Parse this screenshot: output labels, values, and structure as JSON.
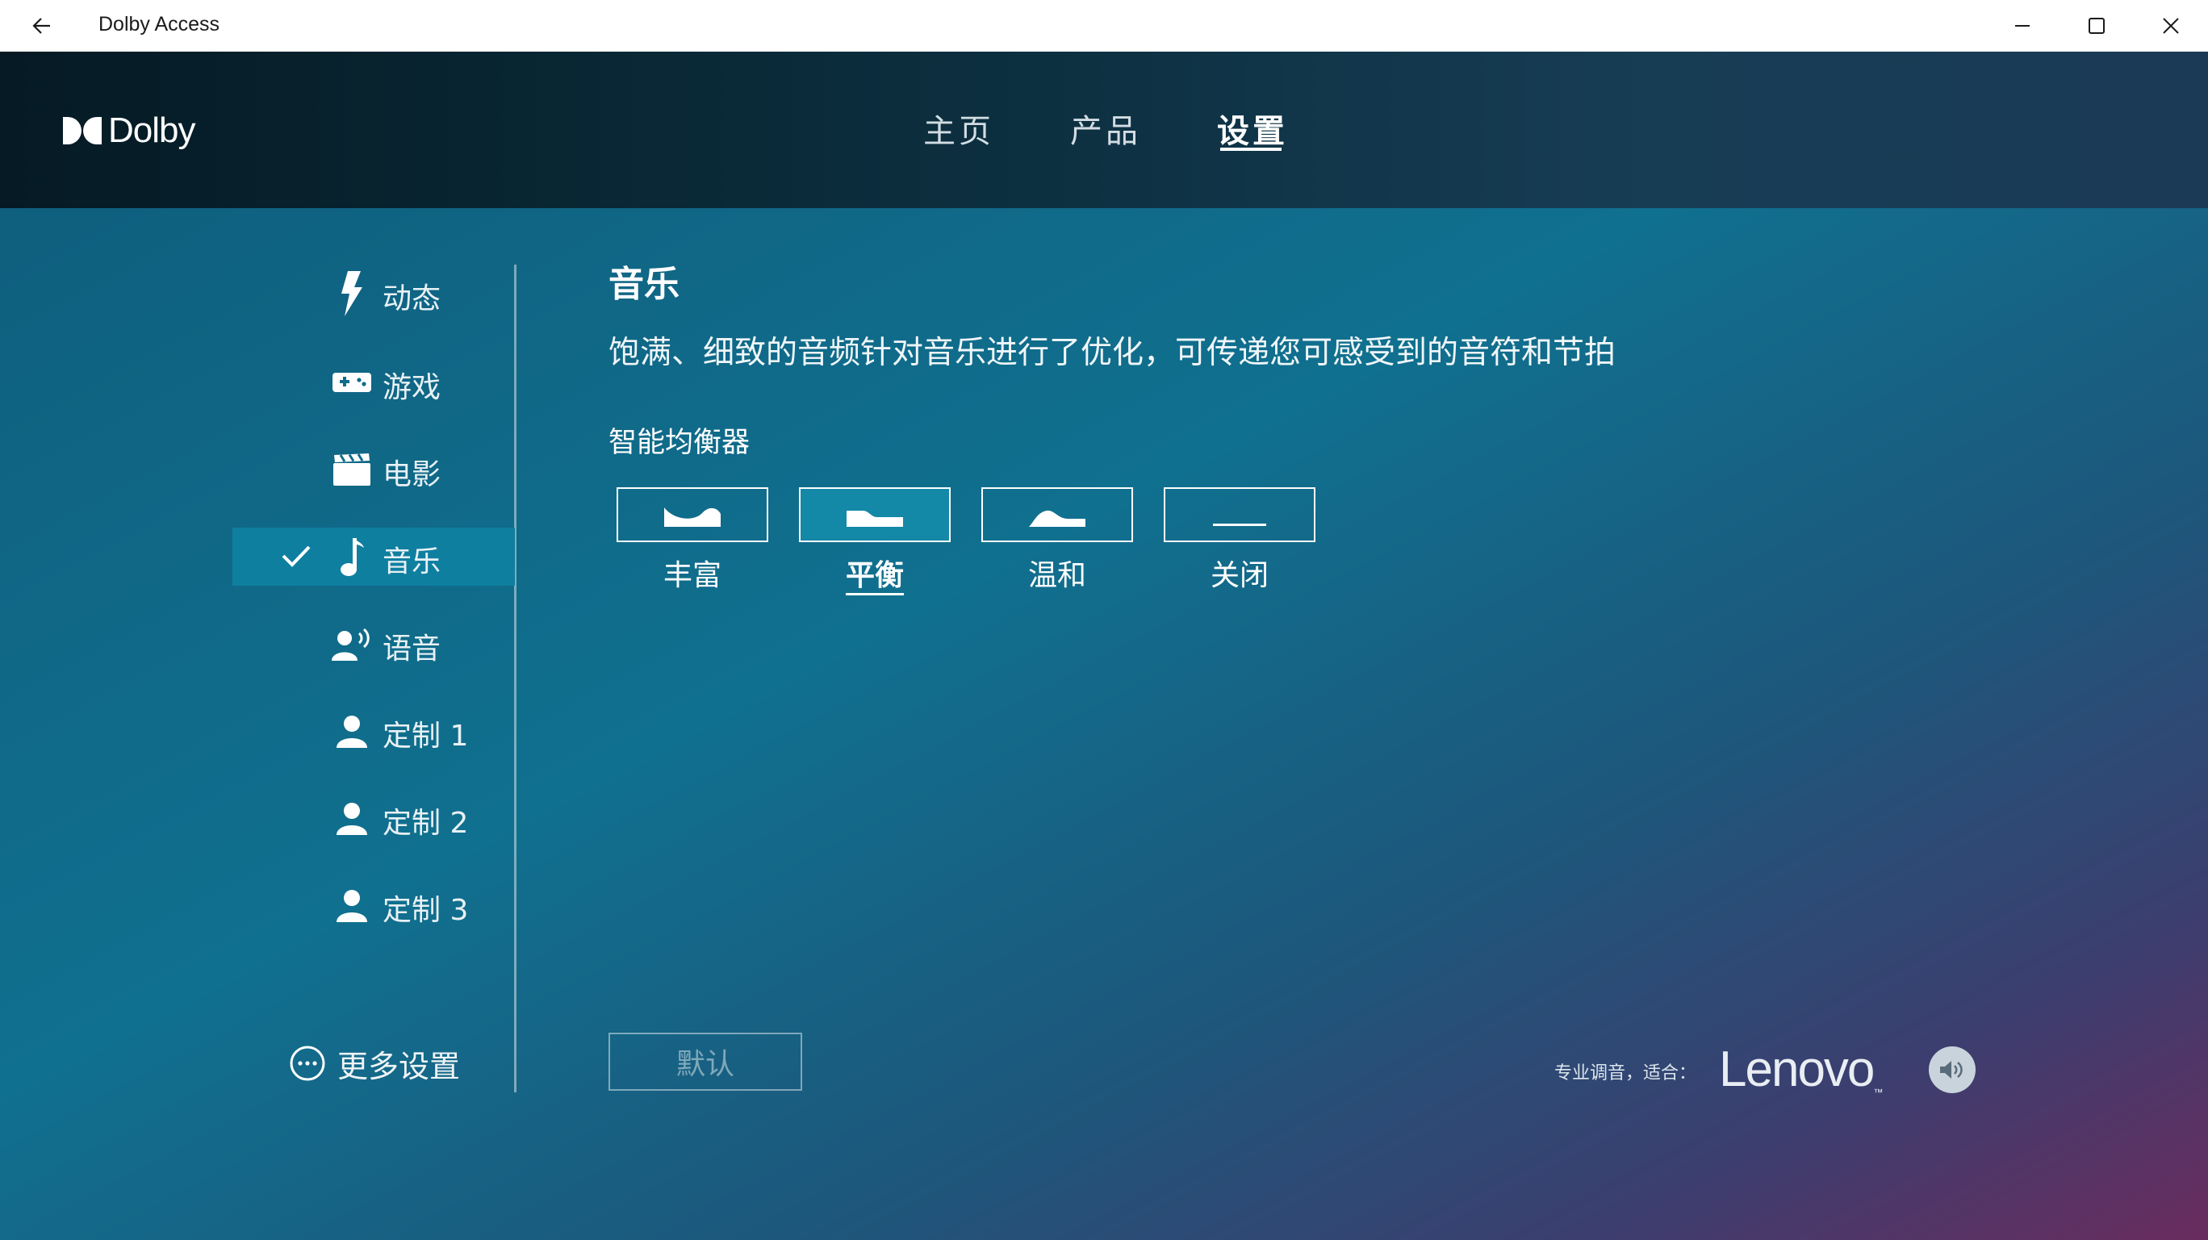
{
  "window": {
    "title": "Dolby Access",
    "icons": {
      "back": "back-arrow-icon",
      "minimize": "minimize-icon",
      "maximize": "maximize-icon",
      "close": "close-icon"
    }
  },
  "header": {
    "logo_text": "Dolby",
    "nav": [
      {
        "label": "主页",
        "active": false
      },
      {
        "label": "产品",
        "active": false
      },
      {
        "label": "设置",
        "active": true
      }
    ]
  },
  "sidebar": {
    "items": [
      {
        "label": "动态",
        "icon": "lightning-icon",
        "selected": false
      },
      {
        "label": "游戏",
        "icon": "gamepad-icon",
        "selected": false
      },
      {
        "label": "电影",
        "icon": "clapperboard-icon",
        "selected": false
      },
      {
        "label": "音乐",
        "icon": "music-note-icon",
        "selected": true
      },
      {
        "label": "语音",
        "icon": "voice-icon",
        "selected": false
      },
      {
        "label": "定制 1",
        "icon": "person-icon",
        "selected": false
      },
      {
        "label": "定制 2",
        "icon": "person-icon",
        "selected": false
      },
      {
        "label": "定制 3",
        "icon": "person-icon",
        "selected": false
      }
    ],
    "more_settings": "更多设置"
  },
  "content": {
    "title": "音乐",
    "description": "饱满、细致的音频针对音乐进行了优化，可传递您可感受到的音符和节拍",
    "equalizer": {
      "title": "智能均衡器",
      "options": [
        {
          "label": "丰富",
          "selected": false
        },
        {
          "label": "平衡",
          "selected": true
        },
        {
          "label": "温和",
          "selected": false
        },
        {
          "label": "关闭",
          "selected": false
        }
      ]
    },
    "default_button": "默认"
  },
  "footer": {
    "tuned_label": "专业调音，适合：",
    "brand": "Lenovo",
    "brand_tm": "™"
  },
  "colors": {
    "header_bg": "#0c2f3f",
    "selected_bg": "#0f7fa0",
    "main_bg_start": "#0f5f7e",
    "main_bg_end": "#6a2c5e"
  }
}
